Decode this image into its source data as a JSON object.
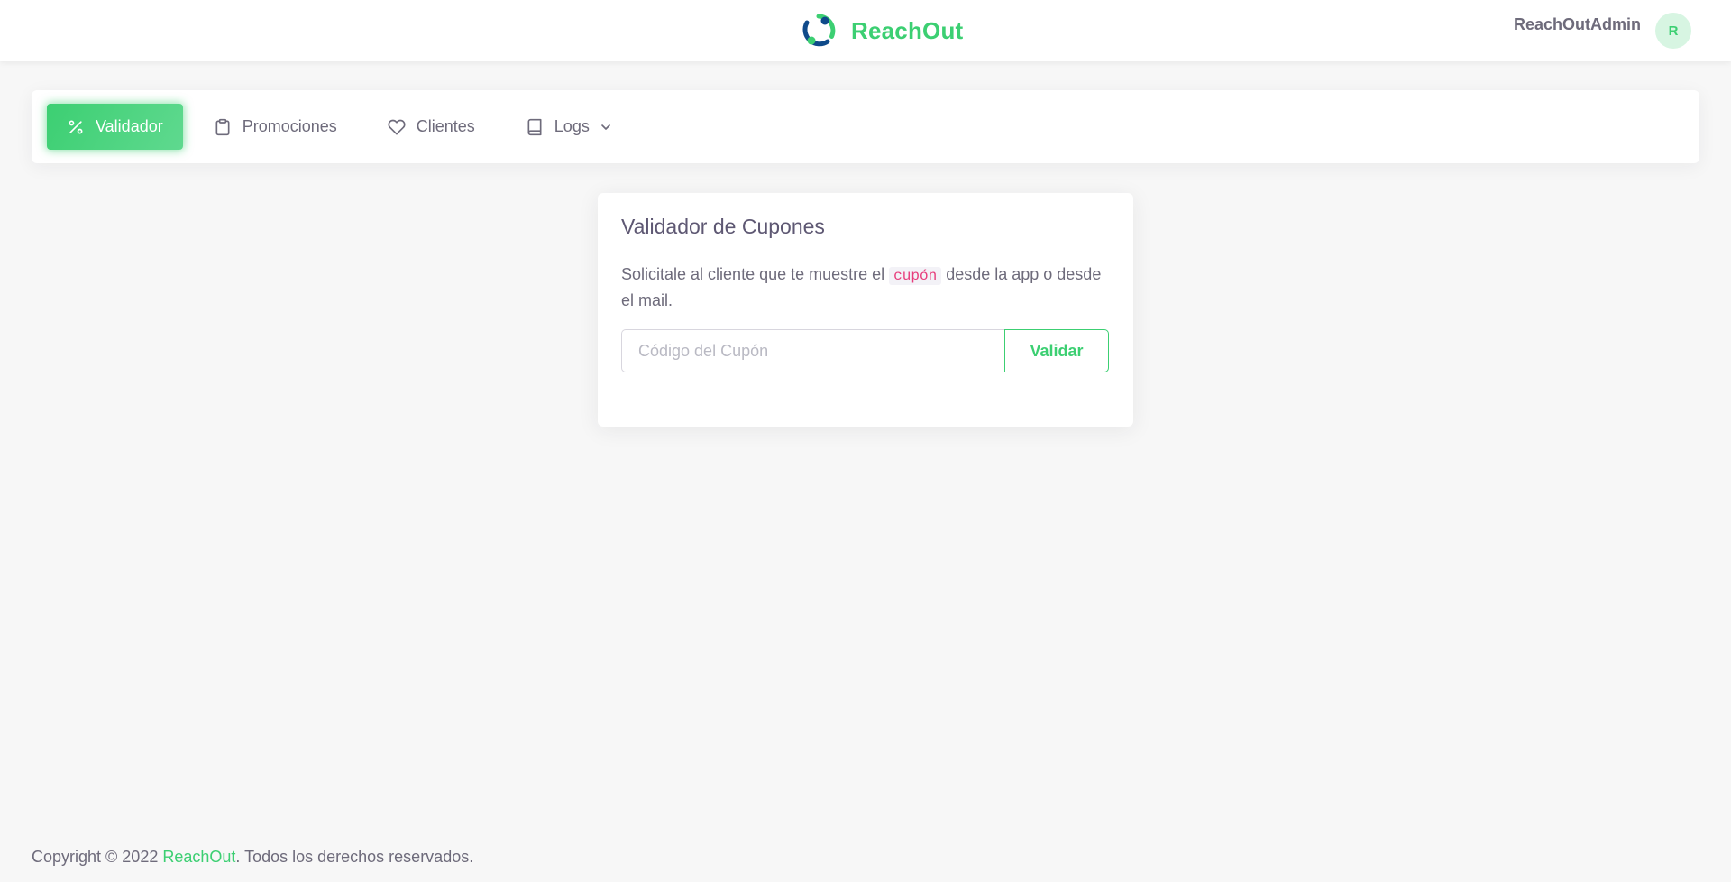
{
  "header": {
    "brand_name": "ReachOut",
    "user_name": "ReachOutAdmin",
    "avatar_initial": "R"
  },
  "nav": {
    "items": [
      {
        "label": "Validador",
        "icon": "percent-icon",
        "active": true
      },
      {
        "label": "Promociones",
        "icon": "clipboard-icon",
        "active": false
      },
      {
        "label": "Clientes",
        "icon": "heart-icon",
        "active": false
      },
      {
        "label": "Logs",
        "icon": "book-icon",
        "active": false,
        "has_dropdown": true
      }
    ]
  },
  "card": {
    "title": "Validador de Cupones",
    "text_before": "Solicitale al cliente que te muestre el ",
    "code_word": "cupón",
    "text_after": " desde la app o desde el mail.",
    "input_placeholder": "Código del Cupón",
    "input_value": "",
    "button_label": "Validar"
  },
  "footer": {
    "prefix": "Copyright © 2022 ",
    "brand_link": "ReachOut",
    "suffix": ". Todos los derechos reservados."
  },
  "colors": {
    "accent": "#3ccf72",
    "logo_blue": "#0f4a8a",
    "background": "#f7f7f7",
    "code_text": "#e73d7c"
  }
}
